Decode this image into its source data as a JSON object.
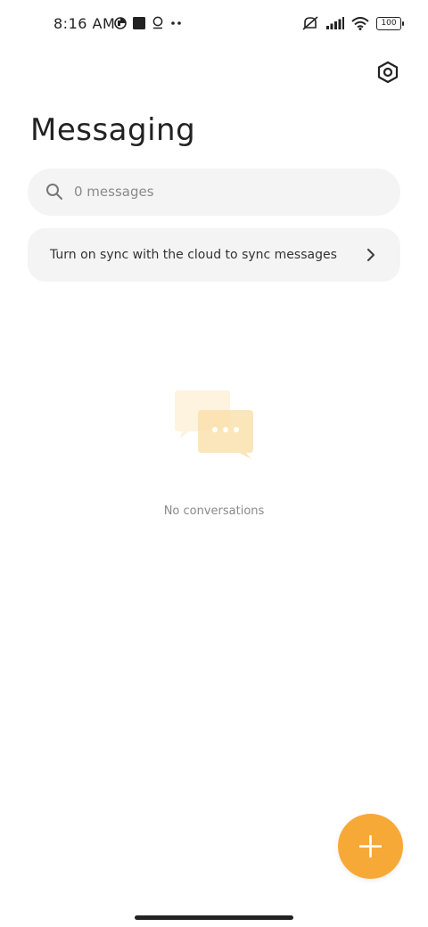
{
  "status_bar": {
    "time": "8:16 AM",
    "battery": "100"
  },
  "header": {
    "title": "Messaging",
    "settings_icon": "gear-icon"
  },
  "search": {
    "placeholder": "0 messages",
    "icon": "search-icon"
  },
  "sync_banner": {
    "label": "Turn on sync with the cloud to sync messages",
    "icon": "chevron-right-icon"
  },
  "empty_state": {
    "label": "No conversations",
    "icon": "chat-bubbles-icon"
  },
  "fab": {
    "icon": "plus-icon"
  },
  "colors": {
    "accent": "#f7a937",
    "panel": "#f4f4f4",
    "illustration_light": "#fdf3df",
    "illustration_mid": "#fbe6bc"
  }
}
